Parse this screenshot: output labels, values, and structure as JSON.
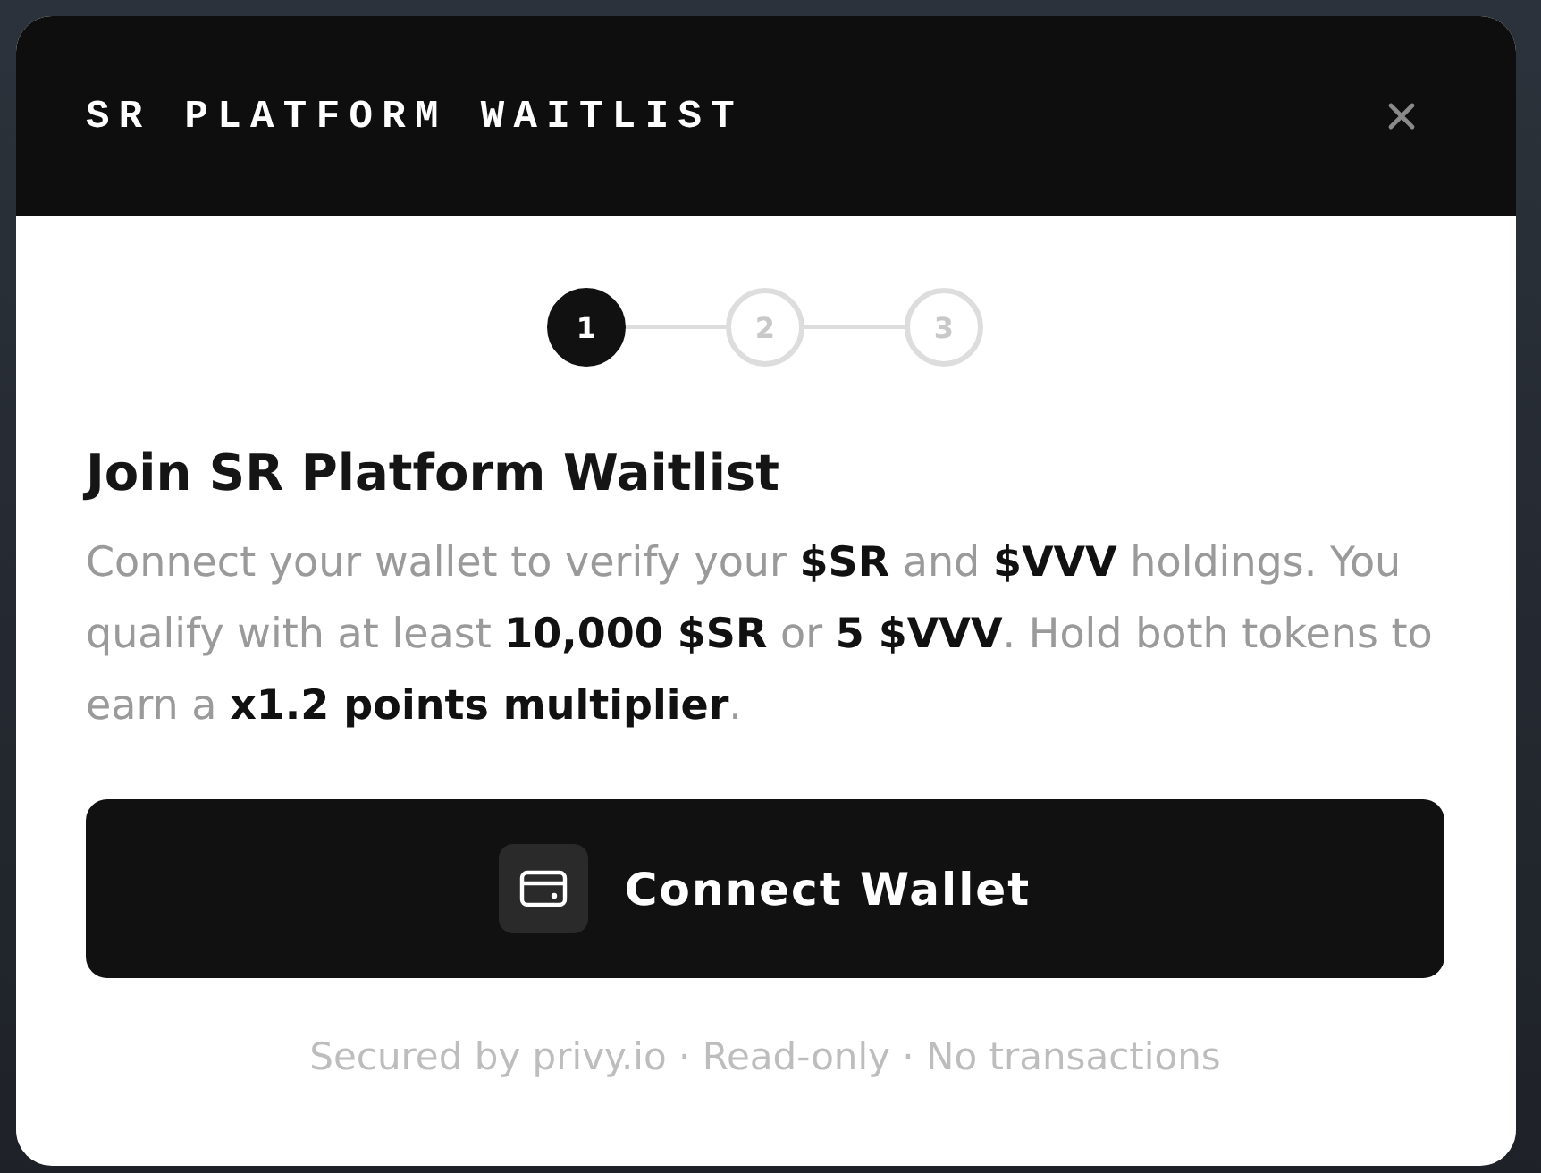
{
  "window": {
    "title": "SR PLATFORM WAITLIST"
  },
  "steps": [
    {
      "label": "1",
      "selected": true
    },
    {
      "label": "2",
      "selected": false
    },
    {
      "label": "3",
      "selected": false
    }
  ],
  "heading": "Join SR Platform Waitlist",
  "description": "Connect your wallet to verify your **$SR** and **$VVV** holdings. You qualify with at least **10,000 $SR** or **5 $VVV**. Hold both tokens to earn a **x1.2 points multiplier**.",
  "connect_button": {
    "label": "Connect Wallet"
  },
  "footer": "Secured by privy.io · Read-only · No transactions"
}
